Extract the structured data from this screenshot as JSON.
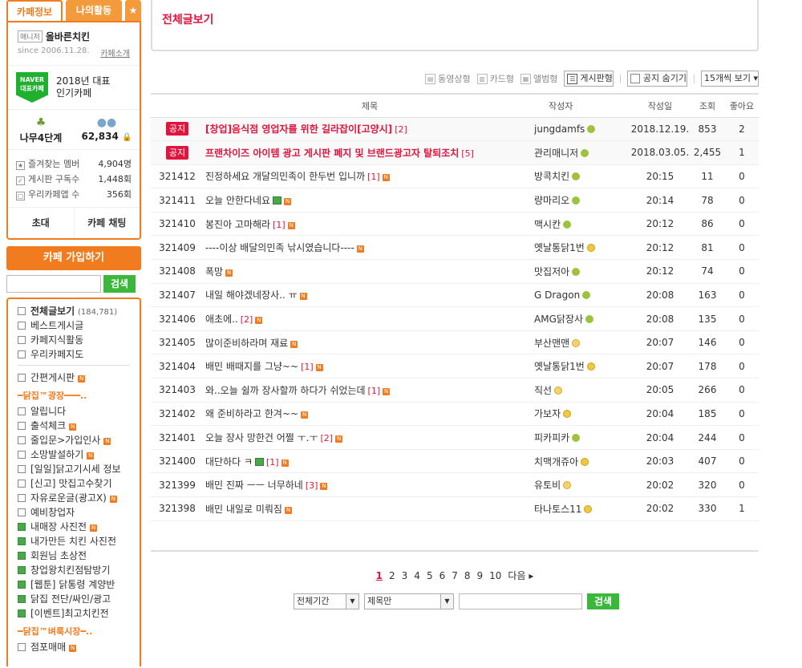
{
  "sidebar": {
    "tabs": {
      "cafe_info": "카페정보",
      "my_activity": "나의활동",
      "star": "★"
    },
    "manager_tag": "매니저",
    "manager": "올바른치킨",
    "since": "since 2006.11.28.",
    "intro_link": "카페소개",
    "award_badge": "NAVER 대표카페",
    "award_line1": "2018년 대표",
    "award_line2": "인기카페",
    "level_label": "나무4단계",
    "member_count": "62,834",
    "stats": [
      {
        "label": "즐겨찾는 멤버",
        "value": "4,904명"
      },
      {
        "label": "게시판 구독수",
        "value": "1,448회"
      },
      {
        "label": "우리카페앱 수",
        "value": "356회"
      }
    ],
    "invite": "초대",
    "chat": "카페 채팅",
    "join": "카페 가입하기",
    "search_btn": "검색",
    "menu_top": [
      {
        "label": "전체글보기",
        "count": "(184,781)"
      },
      {
        "label": "베스트게시글"
      },
      {
        "label": "카페지식활동"
      },
      {
        "label": "우리카페지도"
      }
    ],
    "simple_board": "간편게시판",
    "section1": "━닭집™광장━━━..",
    "menu_main": [
      "알립니다",
      "출석체크",
      "줄입문>가입인사",
      "소망발설하기",
      "[일일]닭고기시세 정보",
      "[신고] 맛집고수찾기",
      "자유로운글(광고X)",
      "예비창업자",
      "내매장 사진전",
      "내가만든 치킨 사진전",
      "회원님 초상전",
      "창업왕치킨점탐방기",
      "[웹툰] 닭통령 계양반",
      "닭집 전단/싸인/광고",
      "[이벤트]최고치킨전"
    ],
    "section2": "━닭집™벼룩시장━..",
    "menu_market": [
      "점포매매"
    ]
  },
  "main": {
    "title": "전체글보기",
    "view_options": [
      "동영상형",
      "카드형",
      "앨범형",
      "게시판형"
    ],
    "hide_notice": "공지 숨기기",
    "per_page": "15개씩 보기 ▾",
    "columns": {
      "title": "제목",
      "author": "작성자",
      "date": "작성일",
      "views": "조회",
      "likes": "좋아요"
    },
    "notices": [
      {
        "badge": "공지",
        "title": "[창업]음식점 영업자를 위한 길라잡이[고양시]",
        "comments": "[2]",
        "author": "jungdamfs",
        "date": "2018.12.19.",
        "views": "853",
        "likes": "2"
      },
      {
        "badge": "공지",
        "title": "프랜차이즈 아이템 광고 게시판 폐지 및 브랜드광고자 탈퇴조치",
        "comments": "[5]",
        "author": "관리매니저",
        "date": "2018.03.05.",
        "views": "2,455",
        "likes": "1"
      }
    ],
    "posts": [
      {
        "no": "321412",
        "title": "진정하세요 개달의민족이 한두번 입니까",
        "comments": "[1]",
        "img": false,
        "author": "방콕치킨",
        "lv": "g",
        "time": "20:15",
        "views": "11",
        "likes": "0"
      },
      {
        "no": "321411",
        "title": "오늘 안한다네요",
        "comments": "",
        "img": true,
        "author": "량마리오",
        "lv": "g",
        "time": "20:14",
        "views": "78",
        "likes": "0"
      },
      {
        "no": "321410",
        "title": "봉진아 고마해라",
        "comments": "[1]",
        "img": false,
        "author": "맥시칸",
        "lv": "g",
        "time": "20:12",
        "views": "86",
        "likes": "0"
      },
      {
        "no": "321409",
        "title": "----이상 배달의민족 낚시였습니다----",
        "comments": "",
        "img": false,
        "author": "옛날통닭1번",
        "lv": "y",
        "time": "20:12",
        "views": "81",
        "likes": "0"
      },
      {
        "no": "321408",
        "title": "폭망",
        "comments": "",
        "img": false,
        "author": "맛집저아",
        "lv": "g",
        "time": "20:12",
        "views": "74",
        "likes": "0"
      },
      {
        "no": "321407",
        "title": "내일 해야겠네장사.. ㅠ",
        "comments": "",
        "img": false,
        "author": "G Dragon",
        "lv": "g",
        "time": "20:08",
        "views": "163",
        "likes": "0"
      },
      {
        "no": "321406",
        "title": "애초에..",
        "comments": "[2]",
        "img": false,
        "author": "AMG닭장사",
        "lv": "g",
        "time": "20:08",
        "views": "135",
        "likes": "0"
      },
      {
        "no": "321405",
        "title": "많이준비하라며 재료",
        "comments": "",
        "img": false,
        "author": "부산맨맨",
        "lv": "o",
        "time": "20:07",
        "views": "146",
        "likes": "0"
      },
      {
        "no": "321404",
        "title": "배민 배때지를 그냥~~",
        "comments": "[1]",
        "img": false,
        "author": "옛날통닭1번",
        "lv": "y",
        "time": "20:07",
        "views": "178",
        "likes": "0"
      },
      {
        "no": "321403",
        "title": "와..오늘 쉴까 장사할까 하다가 쉬었는데",
        "comments": "[1]",
        "img": false,
        "author": "직선",
        "lv": "o",
        "time": "20:05",
        "views": "266",
        "likes": "0"
      },
      {
        "no": "321402",
        "title": "왜 준비하라고 한겨~~",
        "comments": "",
        "img": false,
        "author": "가보자",
        "lv": "y",
        "time": "20:04",
        "views": "185",
        "likes": "0"
      },
      {
        "no": "321401",
        "title": "오늘 장사 망한건 어쩔 ㅜ.ㅜ",
        "comments": "[2]",
        "img": false,
        "author": "피카피카",
        "lv": "g",
        "time": "20:04",
        "views": "244",
        "likes": "0"
      },
      {
        "no": "321400",
        "title": "대단하다 ㅋ",
        "comments": "[1]",
        "img": true,
        "author": "치맥개쥬아",
        "lv": "y",
        "time": "20:03",
        "views": "407",
        "likes": "0"
      },
      {
        "no": "321399",
        "title": "배민 진짜 ㅡㅡ 너무하네",
        "comments": "[3]",
        "img": false,
        "author": "유토비",
        "lv": "o",
        "time": "20:02",
        "views": "320",
        "likes": "0"
      },
      {
        "no": "321398",
        "title": "배민 내일로 미뤄짐",
        "comments": "",
        "img": false,
        "author": "타나토스11",
        "lv": "y",
        "time": "20:02",
        "views": "330",
        "likes": "1"
      }
    ],
    "pages": [
      "1",
      "2",
      "3",
      "4",
      "5",
      "6",
      "7",
      "8",
      "9",
      "10"
    ],
    "next": "다음 ▸",
    "search_period": "전체기간",
    "search_type": "제목만",
    "search_btn": "검색"
  },
  "colors": {
    "accent": "#f07c1f",
    "notice_red": "#e0143c",
    "search_green": "#3bb83b"
  }
}
